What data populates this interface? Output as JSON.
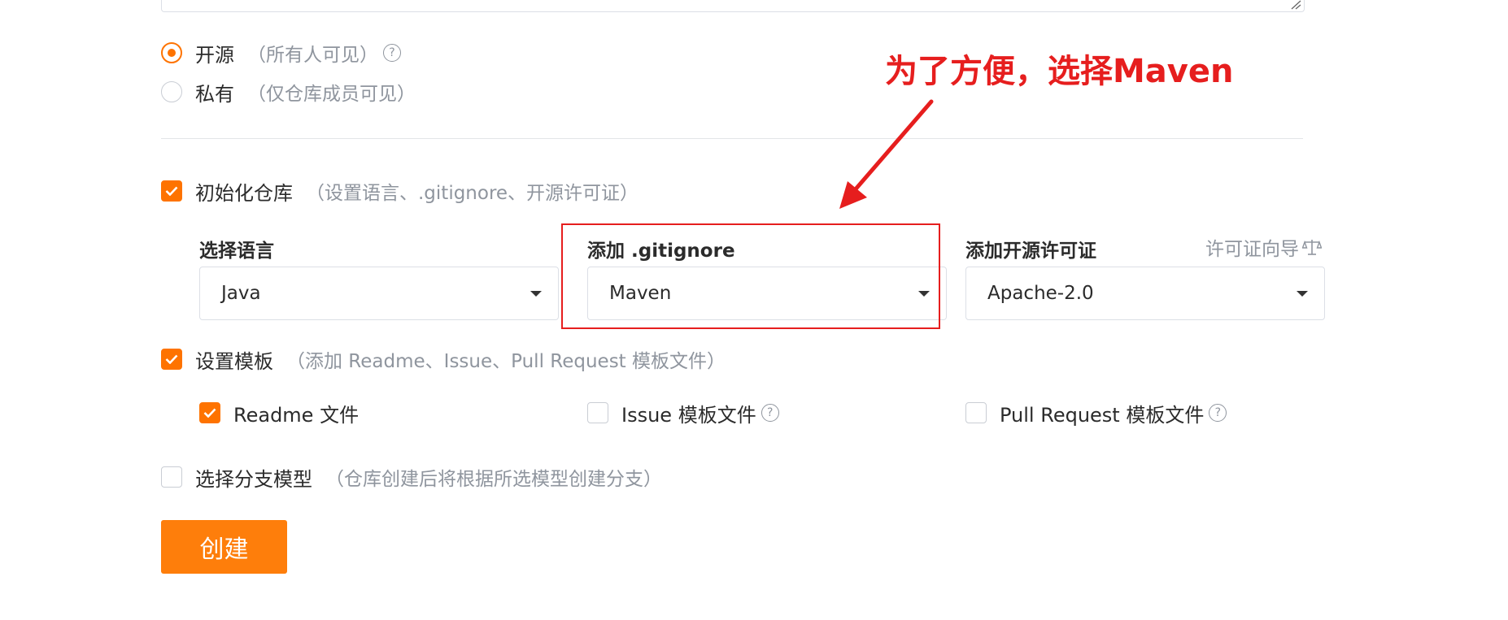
{
  "visibility": {
    "options": [
      {
        "label": "开源",
        "hint": "（所有人可见）",
        "checked": true,
        "help": true
      },
      {
        "label": "私有",
        "hint": "（仅仓库成员可见）",
        "checked": false,
        "help": false
      }
    ]
  },
  "init_repo": {
    "label": "初始化仓库",
    "hint": "（设置语言、.gitignore、开源许可证）",
    "checked": true,
    "language": {
      "label": "选择语言",
      "value": "Java"
    },
    "gitignore": {
      "label": "添加 .gitignore",
      "value": "Maven"
    },
    "license": {
      "label": "添加开源许可证",
      "value": "Apache-2.0",
      "wizard_link": "许可证向导"
    }
  },
  "templates": {
    "label": "设置模板",
    "hint": "（添加 Readme、Issue、Pull Request 模板文件）",
    "checked": true,
    "items": [
      {
        "label": "Readme 文件",
        "checked": true,
        "help": false
      },
      {
        "label": "Issue 模板文件",
        "checked": false,
        "help": true
      },
      {
        "label": "Pull Request 模板文件",
        "checked": false,
        "help": true
      }
    ]
  },
  "branch_model": {
    "label": "选择分支模型",
    "hint": "（仓库创建后将根据所选模型创建分支）",
    "checked": false
  },
  "create_button": "创建",
  "annotation": {
    "text": "为了方便，选择Maven",
    "color": "#e61e1e"
  },
  "colors": {
    "accent": "#fe7300",
    "hint": "#8f959e",
    "annotation_red": "#e61e1e"
  },
  "icons": {
    "help": "question-circle-icon",
    "scale": "scale-icon",
    "caret": "caret-down-icon",
    "check": "check-icon"
  }
}
